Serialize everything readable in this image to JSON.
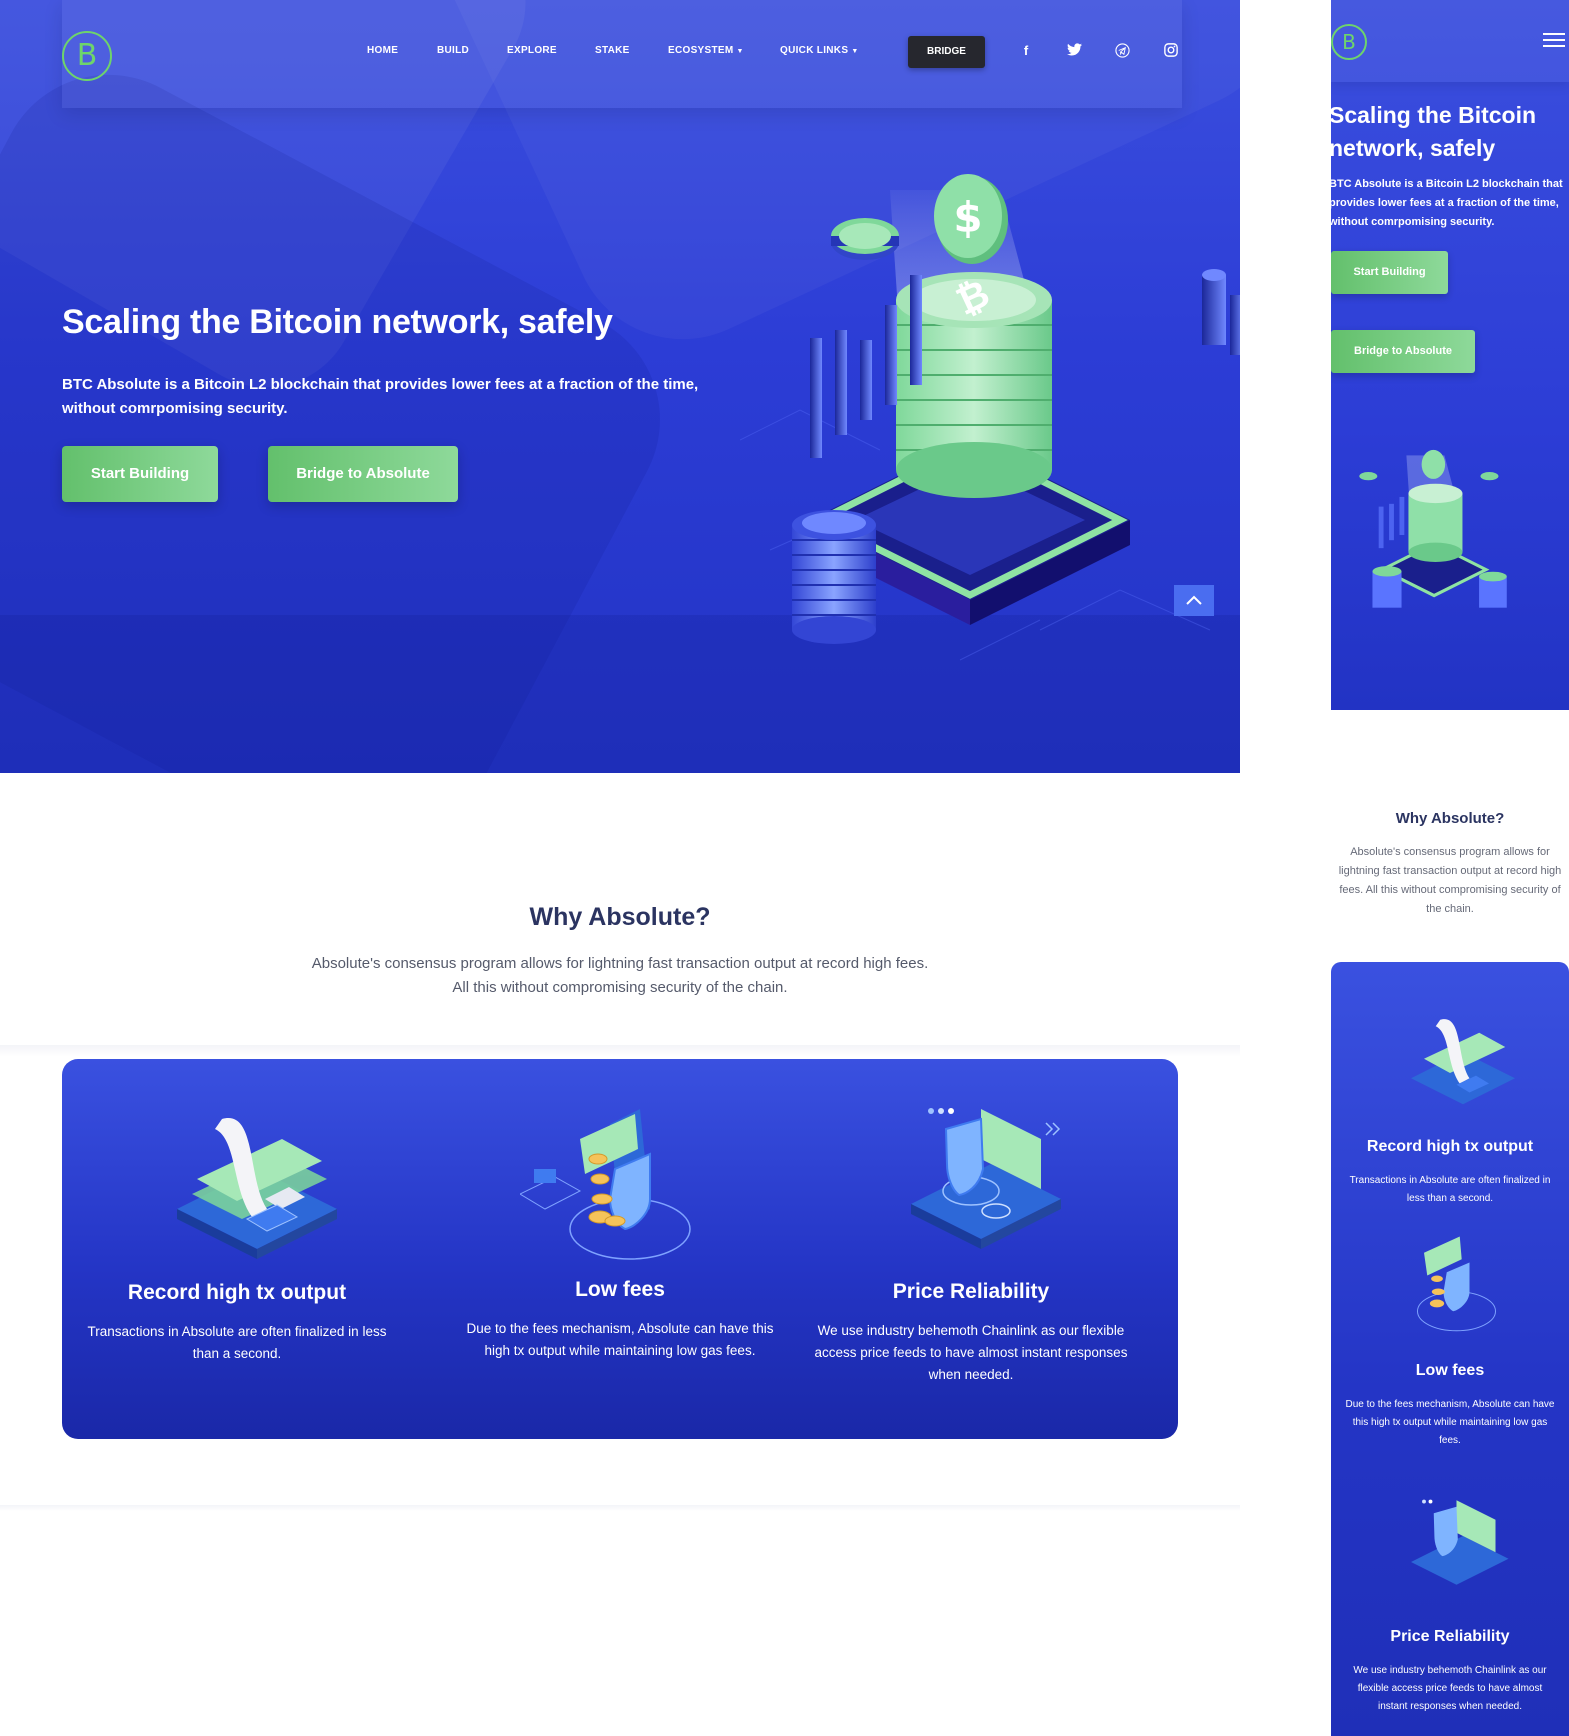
{
  "nav": {
    "items": [
      "HOME",
      "BUILD",
      "EXPLORE",
      "STAKE",
      "ECOSYSTEM",
      "QUICK LINKS"
    ],
    "bridge_label": "BRIDGE",
    "social": [
      "facebook-icon",
      "twitter-icon",
      "telegram-icon",
      "instagram-icon"
    ],
    "logo_glyph": "B"
  },
  "hero": {
    "title": "Scaling the Bitcoin network, safely",
    "description": "BTC Absolute is a Bitcoin L2 blockchain that provides lower fees at a fraction of the time, without comrpomising security.",
    "primary_button": "Start Building",
    "secondary_button": "Bridge to Absolute",
    "coin_glyph": "₿"
  },
  "why": {
    "title": "Why Absolute?",
    "description": "Absolute's consensus program allows for lightning fast transaction output at record high fees. All this without compromising security of the chain."
  },
  "features": [
    {
      "title": "Record high tx output",
      "description": "Transactions in Absolute are often finalized in less than a second."
    },
    {
      "title": "Low fees",
      "description": "Due to the fees mechanism, Absolute can have this high tx output while maintaining low gas fees."
    },
    {
      "title": "Price Reliability",
      "description": "We use industry behemoth Chainlink as our flexible access price feeds to have almost instant responses when needed."
    }
  ],
  "colors": {
    "primary_blue": "#2c3dd6",
    "accent_green": "#6ed46b",
    "dark_button": "#26272e",
    "heading_navy": "#2b3461"
  }
}
